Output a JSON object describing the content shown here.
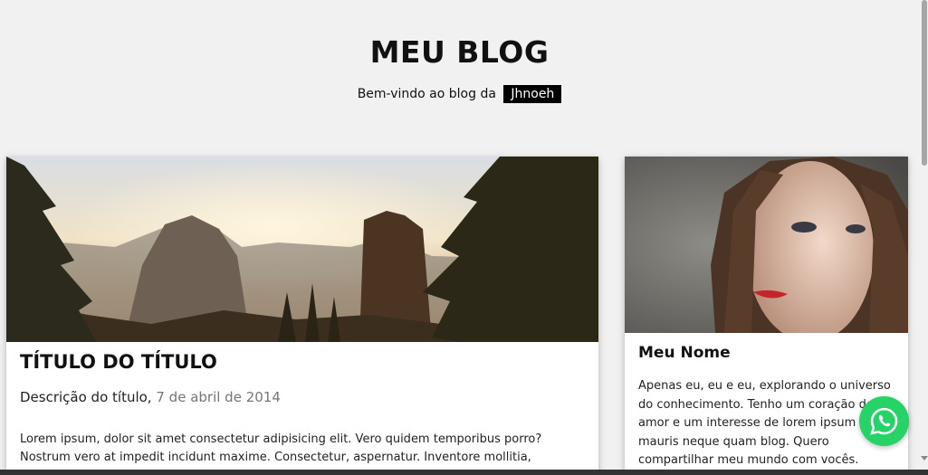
{
  "header": {
    "title": "MEU BLOG",
    "welcome_text": "Bem-vindo ao blog da",
    "author_badge": "Jhnoeh"
  },
  "post": {
    "image_icon": "landscape-photo",
    "title": "TÍTULO DO TÍTULO",
    "description": "Descrição do título,",
    "date": "7 de abril de 2014",
    "body": "Lorem ipsum, dolor sit amet consectetur adipisicing elit. Vero quidem temporibus porro? Nostrum vero at impedit incidunt maxime. Consectetur, aspernatur. Inventore mollitia, numquam est rem"
  },
  "profile": {
    "image_icon": "portrait-photo",
    "name": "Meu Nome",
    "bio": "Apenas eu, eu e eu, explorando o universo do conhecimento. Tenho um coração de amor e um interesse de lorem ipsum e mauris neque quam blog. Quero compartilhar meu mundo com vocês."
  },
  "floating_button": {
    "icon": "whatsapp-icon",
    "color": "#25d366"
  },
  "colors": {
    "background": "#f1f1f1",
    "badge_background": "#000000",
    "date_text": "#757575"
  }
}
